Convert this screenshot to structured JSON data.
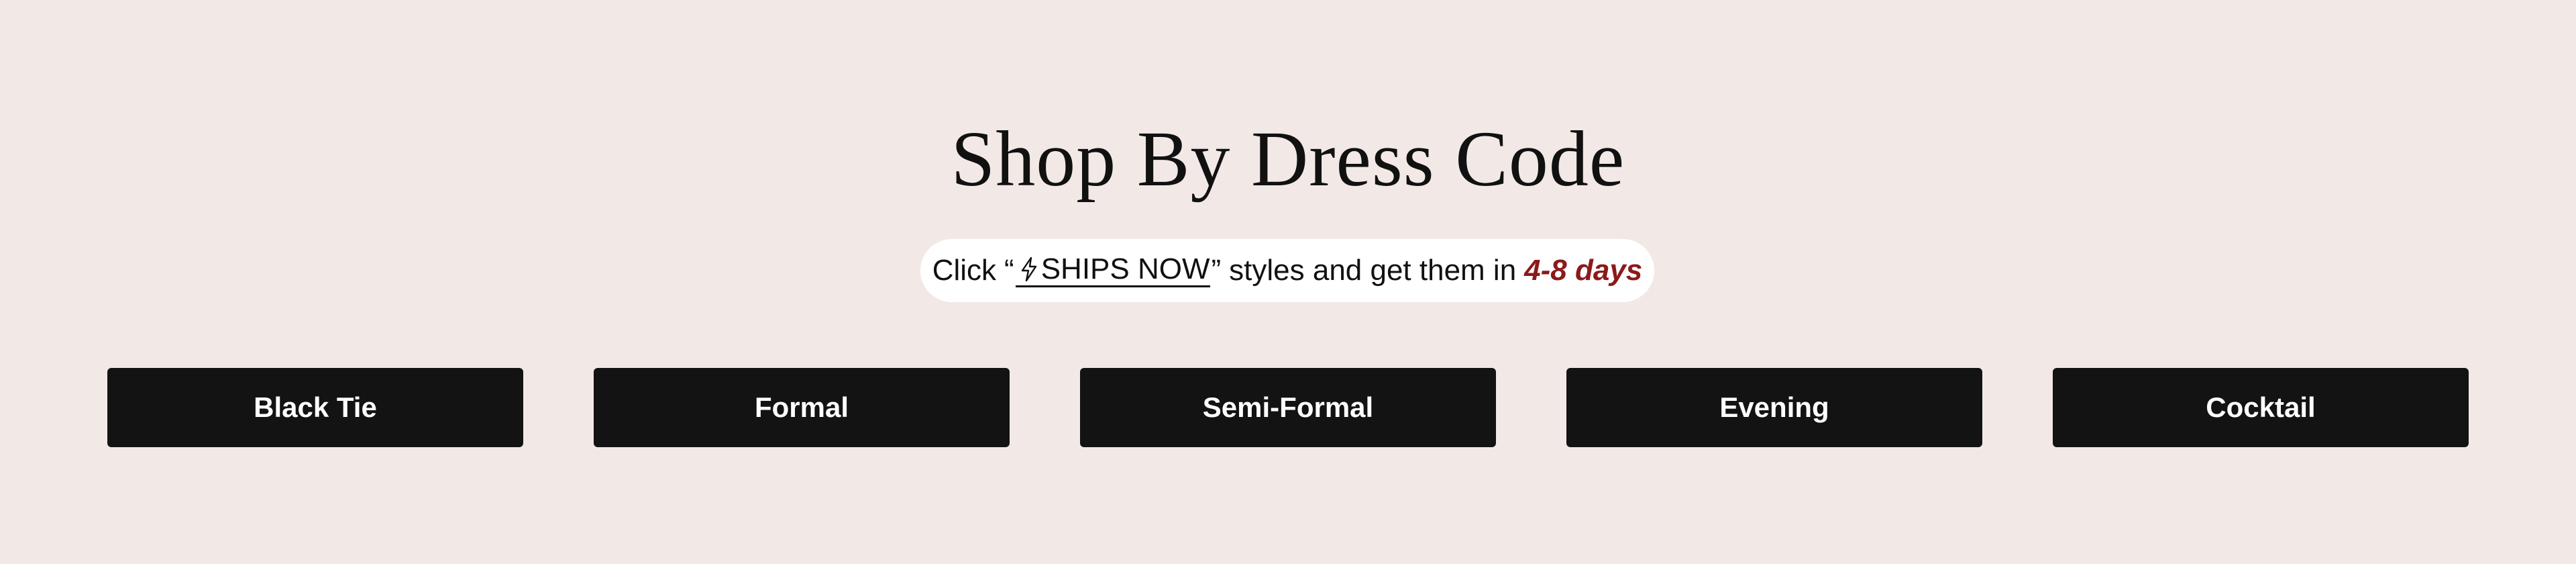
{
  "section": {
    "title": "Shop By Dress Code"
  },
  "promo": {
    "prefix": "Click",
    "open_quote": "“",
    "link_label": "SHIPS NOW",
    "close_quote": "”",
    "middle": "styles and get them in",
    "days": "4-8 days",
    "days_color": "#8b1a1a",
    "link_icon": "lightning-bolt-icon"
  },
  "dress_codes": [
    {
      "label": "Black Tie"
    },
    {
      "label": "Formal"
    },
    {
      "label": "Semi-Formal"
    },
    {
      "label": "Evening"
    },
    {
      "label": "Cocktail"
    }
  ],
  "colors": {
    "background": "#f2e9e6",
    "button": "#131313",
    "button_text": "#ffffff",
    "pill": "#ffffff"
  }
}
